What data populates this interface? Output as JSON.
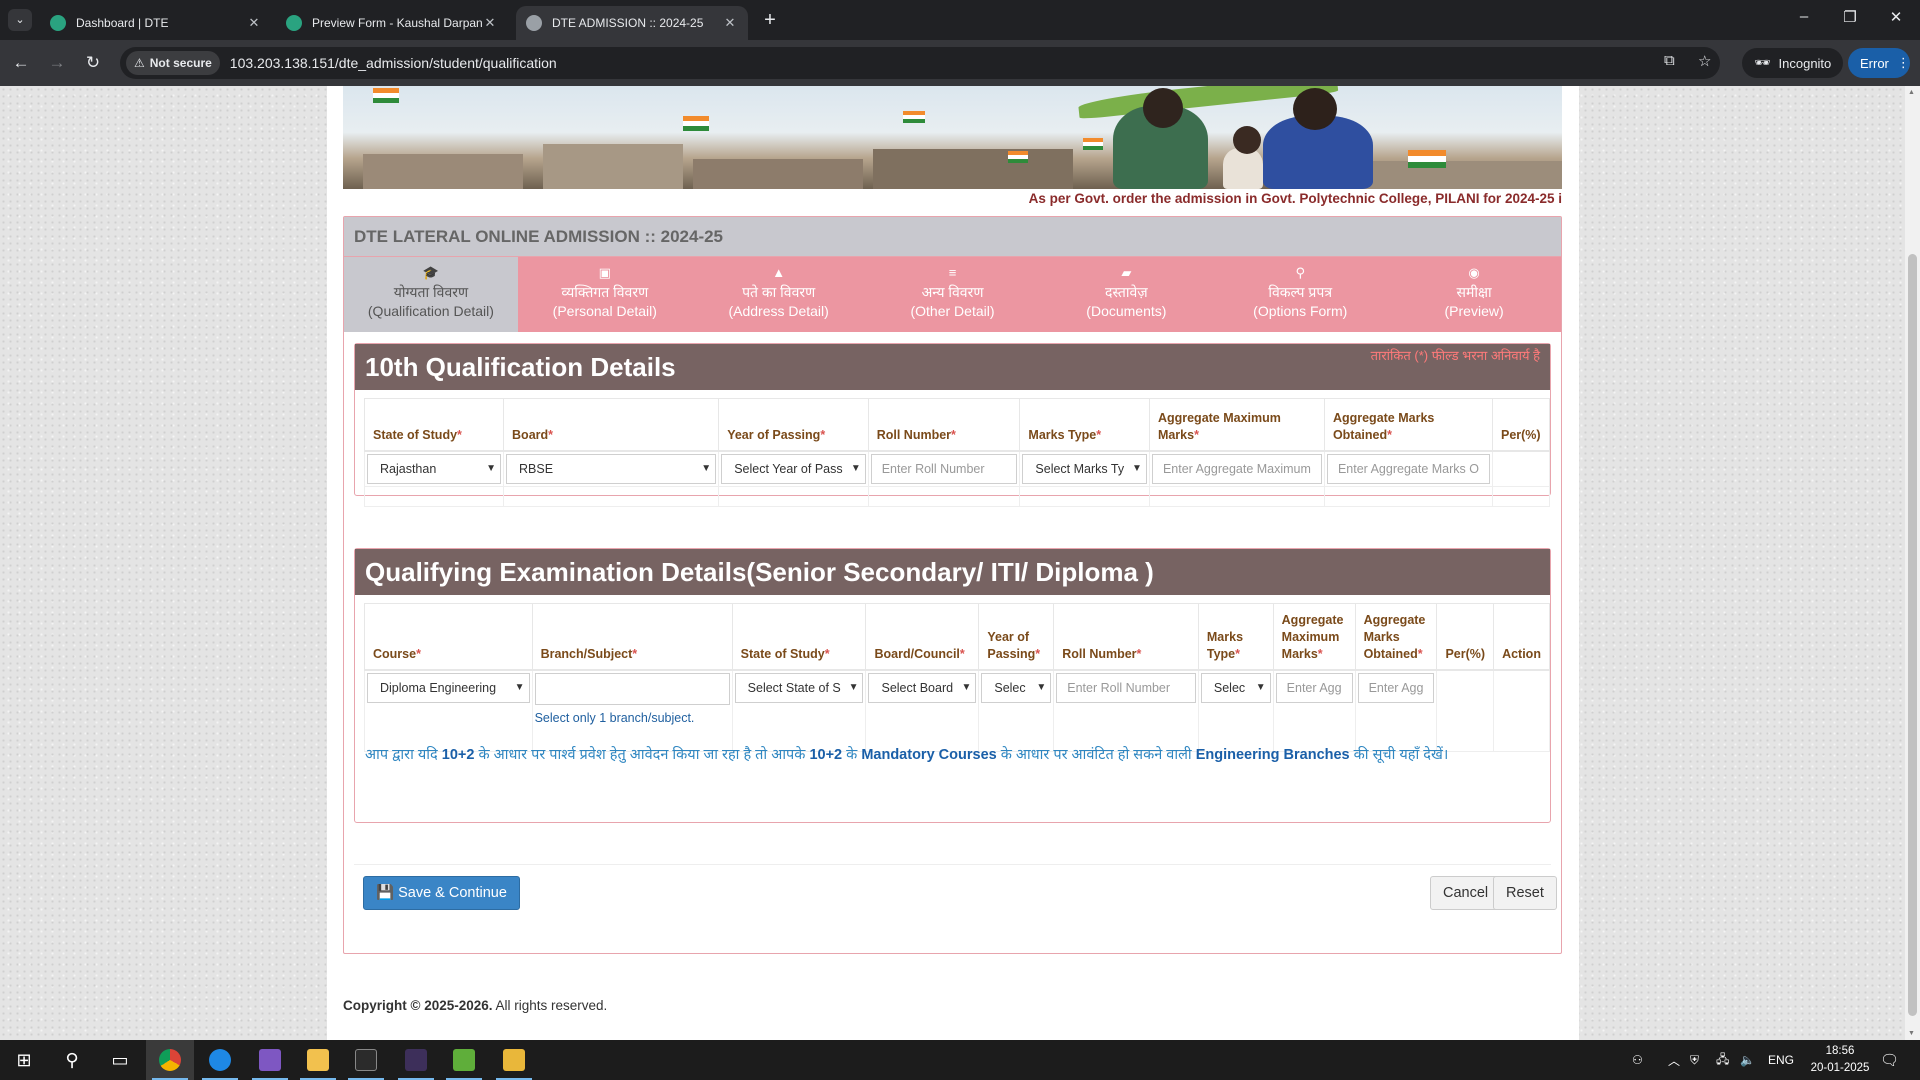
{
  "browser": {
    "tabs": [
      {
        "title": "Dashboard | DTE",
        "close": "✕"
      },
      {
        "title": "Preview Form - Kaushal Darpan",
        "close": "✕"
      },
      {
        "title": "DTE ADMISSION :: 2024-25",
        "close": "✕"
      }
    ],
    "new_tab": "+",
    "not_secure": "Not secure",
    "url": "103.203.138.151/dte_admission/student/qualification",
    "incognito": "Incognito",
    "error": "Error"
  },
  "ticker": "As per Govt. order the admission in Govt. Polytechnic College, PILANI for 2024-25 i",
  "panel_title": "DTE LATERAL ONLINE ADMISSION :: 2024-25",
  "steps": [
    {
      "hi": "योग्यता विवरण",
      "en": "(Qualification Detail)",
      "icon": "graduation-cap-icon"
    },
    {
      "hi": "व्यक्तिगत विवरण",
      "en": "(Personal Detail)",
      "icon": "briefcase-icon"
    },
    {
      "hi": "पते का विवरण",
      "en": "(Address Detail)",
      "icon": "road-icon"
    },
    {
      "hi": "अन्य विवरण",
      "en": "(Other Detail)",
      "icon": "list-icon"
    },
    {
      "hi": "दस्तावेज़",
      "en": "(Documents)",
      "icon": "folder-icon"
    },
    {
      "hi": "विकल्प प्रपत्र",
      "en": "(Options Form)",
      "icon": "link-icon"
    },
    {
      "hi": "समीक्षा",
      "en": "(Preview)",
      "icon": "eye-icon"
    }
  ],
  "tenth": {
    "title": "10th Qualification Details",
    "required_note": "तारांकित (*) फील्ड भरना अनिवार्य है",
    "headers": {
      "state": "State of Study",
      "board": "Board",
      "year": "Year of Passing",
      "roll": "Roll Number",
      "marks_type": "Marks Type",
      "agg_max_1": "Aggregate Maximum",
      "agg_max_2": "Marks",
      "agg_obt_1": "Aggregate Marks",
      "agg_obt_2": "Obtained",
      "per": "Per(%)"
    },
    "values": {
      "state": "Rajasthan",
      "board": "RBSE",
      "year": "Select Year of Pass",
      "roll_ph": "Enter Roll Number",
      "marks_type": "Select Marks Ty",
      "agg_max_ph": "Enter Aggregate Maximum",
      "agg_obt_ph": "Enter Aggregate Marks O"
    }
  },
  "qualifying": {
    "title": "Qualifying Examination Details(Senior Secondary/ ITI/ Diploma )",
    "headers": {
      "course": "Course",
      "branch": "Branch/Subject",
      "state": "State of Study",
      "board": "Board/Council",
      "year_1": "Year of",
      "year_2": "Passing",
      "roll": "Roll Number",
      "mt_1": "Marks",
      "mt_2": "Type",
      "am_1": "Aggregate",
      "am_2": "Maximum",
      "am_3": "Marks",
      "ao_1": "Aggregate",
      "ao_2": "Marks",
      "ao_3": "Obtained",
      "per": "Per(%)",
      "action": "Action"
    },
    "values": {
      "course": "Diploma Engineering",
      "branch": "",
      "branch_hint": "Select only 1 branch/subject.",
      "state": "Select State of S",
      "board": "Select Board",
      "year": "Selec",
      "roll_ph": "Enter Roll Number",
      "marks_type": "Selec",
      "agg_max_ph": "Enter Agg",
      "agg_obt_ph": "Enter Agg"
    },
    "info": {
      "p1": "आप द्वारा यदि ",
      "b1": "10+2",
      "p2": " के आधार पर पार्श्व प्रवेश हेतु आवेदन किया जा रहा है तो आपके ",
      "b2": "10+2",
      "p3": " के ",
      "b3": "Mandatory Courses",
      "p4": " के आधार पर आवंटित हो सकने वाली ",
      "b4": "Engineering Branches",
      "p5": " की सूची यहाँ देखें।"
    }
  },
  "buttons": {
    "save": "Save & Continue",
    "cancel": "Cancel",
    "reset": "Reset"
  },
  "copyright": {
    "bold": "Copyright © 2025-2026.",
    "rest": " All rights reserved."
  },
  "taskbar": {
    "lang": "ENG",
    "time": "18:56",
    "date": "20-01-2025"
  }
}
